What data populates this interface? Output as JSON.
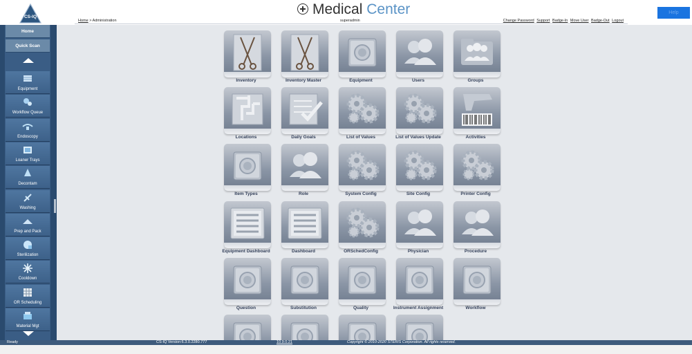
{
  "header": {
    "logo_text": "CS-IQ",
    "title_word1": "Medical",
    "title_word2": "Center",
    "help_label": "Help",
    "breadcrumb_home": "Home",
    "breadcrumb_sep": ">",
    "breadcrumb_current": "Administration",
    "user": "superadmin",
    "links": [
      "Change Password",
      "Support",
      "Badge-In",
      "Move User",
      "Badge-Out",
      "Logout"
    ]
  },
  "sidebar": {
    "home": "Home",
    "quick_scan": "Quick Scan",
    "items": [
      {
        "label": "Equipment",
        "icon": "equipment-icon"
      },
      {
        "label": "Workflow Queue",
        "icon": "workflow-queue-icon"
      },
      {
        "label": "Endoscopy",
        "icon": "endoscopy-icon"
      },
      {
        "label": "Loaner Trays",
        "icon": "loaner-trays-icon"
      },
      {
        "label": "Decontam",
        "icon": "decontam-icon"
      },
      {
        "label": "Washing",
        "icon": "washing-icon"
      },
      {
        "label": "Prep and Pack",
        "icon": "prep-and-pack-icon"
      },
      {
        "label": "Sterilization",
        "icon": "sterilization-icon"
      },
      {
        "label": "Cooldown",
        "icon": "cooldown-icon"
      },
      {
        "label": "OR Scheduling",
        "icon": "or-scheduling-icon"
      },
      {
        "label": "Material Mgt",
        "icon": "material-mgt-icon"
      }
    ]
  },
  "tiles": [
    {
      "label": "Inventory",
      "icon": "instruments-icon"
    },
    {
      "label": "Inventory Master",
      "icon": "instruments-icon"
    },
    {
      "label": "Equipment",
      "icon": "safe-icon"
    },
    {
      "label": "Users",
      "icon": "users-icon"
    },
    {
      "label": "Groups",
      "icon": "group-folder-icon"
    },
    {
      "label": "Locations",
      "icon": "floorplan-icon"
    },
    {
      "label": "Daily Goals",
      "icon": "checklist-icon"
    },
    {
      "label": "List of Values",
      "icon": "gears-icon"
    },
    {
      "label": "List of Values Update",
      "icon": "gears-icon"
    },
    {
      "label": "Activities",
      "icon": "barcode-scanner-icon"
    },
    {
      "label": "Item Types",
      "icon": "safe-icon"
    },
    {
      "label": "Role",
      "icon": "users-icon"
    },
    {
      "label": "System Config",
      "icon": "gears-icon"
    },
    {
      "label": "Site Config",
      "icon": "gears-icon"
    },
    {
      "label": "Printer Config",
      "icon": "gears-icon"
    },
    {
      "label": "Equipment Dashboard",
      "icon": "dashboard-icon"
    },
    {
      "label": "Dashboard",
      "icon": "dashboard-icon"
    },
    {
      "label": "ORSchedConfig",
      "icon": "gears-icon"
    },
    {
      "label": "Physician",
      "icon": "users-icon"
    },
    {
      "label": "Procedure",
      "icon": "users-icon"
    },
    {
      "label": "Question",
      "icon": "safe-icon"
    },
    {
      "label": "Substitution",
      "icon": "safe-icon"
    },
    {
      "label": "Quality",
      "icon": "safe-icon"
    },
    {
      "label": "Instrument Assignment",
      "icon": "safe-icon"
    },
    {
      "label": "Workflow",
      "icon": "safe-icon"
    },
    {
      "label": "",
      "icon": "safe-icon"
    },
    {
      "label": "",
      "icon": "safe-icon"
    },
    {
      "label": "",
      "icon": "safe-icon"
    },
    {
      "label": "",
      "icon": "safe-icon"
    }
  ],
  "status": {
    "state": "Ready",
    "version": "CS-IQ Version:6.3.0.2280.777",
    "ip": "10.9.0.21",
    "copyright": "Copyright © 2010-2020 STERIS Corporation. All rights reserved."
  },
  "colors": {
    "accent": "#1a74e0",
    "sidebar": "#3a5d85",
    "title_accent": "#5a93c6",
    "main_bg": "#e5e8ec"
  }
}
